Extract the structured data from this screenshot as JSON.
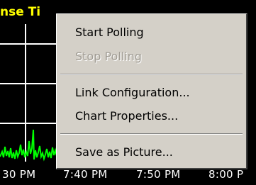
{
  "chart": {
    "title_fragment": "nse Ti",
    "title_color": "#ffff00",
    "series_color": "#00ff00",
    "background": "#000000",
    "x_tick_labels": [
      "30 PM",
      "7:40 PM",
      "7:50 PM",
      "8:00 P"
    ]
  },
  "context_menu": {
    "items": [
      {
        "label": "Start Polling",
        "enabled": true
      },
      {
        "label": "Stop Polling",
        "enabled": false
      },
      {
        "label": "Link Configuration...",
        "enabled": true
      },
      {
        "label": "Chart Properties...",
        "enabled": true
      },
      {
        "label": "Save as Picture...",
        "enabled": true
      }
    ]
  }
}
